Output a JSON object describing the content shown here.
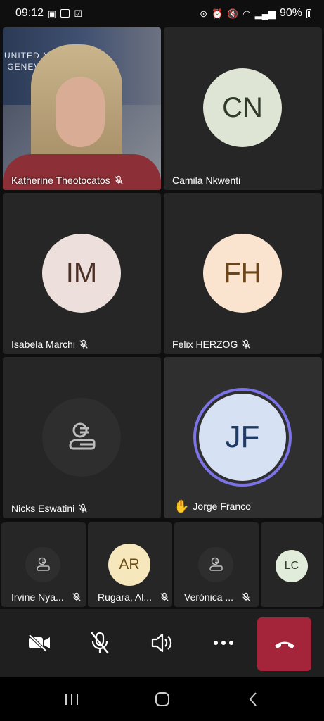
{
  "status_bar": {
    "time": "09:12",
    "battery": "90%"
  },
  "participants_main": [
    {
      "name": "Katherine Theotocatos",
      "muted": true,
      "video": true,
      "video_logo_text": "UNITED NAT\n GENEVA"
    },
    {
      "name": "Camila Nkwenti",
      "muted": false,
      "initials": "CN",
      "avatar_bg": "#dfe5d4",
      "avatar_fg": "#2f3a2a"
    },
    {
      "name": "Isabela Marchi",
      "muted": true,
      "initials": "IM",
      "avatar_bg": "#ede0dc",
      "avatar_fg": "#4a2f26"
    },
    {
      "name": "Felix HERZOG",
      "muted": true,
      "initials": "FH",
      "avatar_bg": "#fae3cf",
      "avatar_fg": "#6a4519"
    },
    {
      "name": "Nicks Eswatini",
      "muted": true,
      "guest": true
    },
    {
      "name": "Jorge Franco",
      "muted": false,
      "initials": "JF",
      "avatar_bg": "#d6e1f3",
      "avatar_fg": "#1f3a63",
      "hand_raised": true,
      "speaking": true
    }
  ],
  "participants_strip": [
    {
      "name": "Irvine Nya...",
      "muted": true,
      "guest": true
    },
    {
      "name": "Rugara, Al...",
      "muted": true,
      "initials": "AR",
      "avatar_bg": "#f6e7bd",
      "avatar_fg": "#6a4a12"
    },
    {
      "name": "Verónica ...",
      "muted": true,
      "guest": true
    },
    {
      "name": "",
      "initials": "LC",
      "avatar_bg": "#e2ecda",
      "avatar_fg": "#2d3a26"
    }
  ],
  "colors": {
    "hangup": "#a4253a",
    "speaking_ring": "#7b73e6",
    "tile_bg": "#262626"
  }
}
